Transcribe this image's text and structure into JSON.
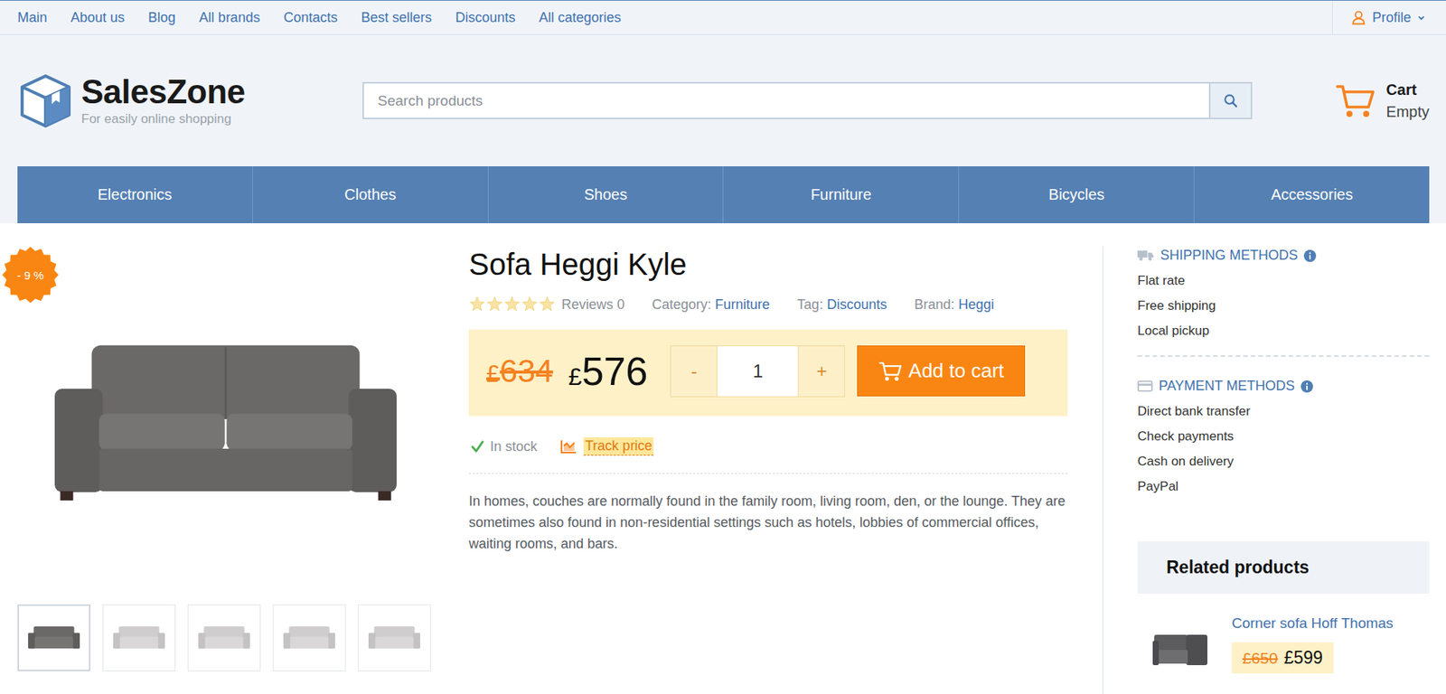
{
  "top_nav": {
    "links": [
      "Main",
      "About us",
      "Blog",
      "All brands",
      "Contacts",
      "Best sellers",
      "Discounts",
      "All categories"
    ],
    "profile": "Profile"
  },
  "logo": {
    "name": "SalesZone",
    "tagline": "For easily online shopping"
  },
  "search": {
    "placeholder": "Search products"
  },
  "cart": {
    "title": "Cart",
    "status": "Empty"
  },
  "categories": [
    "Electronics",
    "Clothes",
    "Shoes",
    "Furniture",
    "Bicycles",
    "Accessories"
  ],
  "product": {
    "badge": "- 9 %",
    "title": "Sofa Heggi Kyle",
    "stars": 0,
    "reviews": "Reviews 0",
    "category_label": "Category:",
    "category": "Furniture",
    "tag_label": "Tag:",
    "tag": "Discounts",
    "brand_label": "Brand:",
    "brand": "Heggi",
    "currency": "£",
    "old_price": "634",
    "price": "576",
    "decrement": "-",
    "quantity": "1",
    "increment": "+",
    "add_to_cart": "Add to cart",
    "stock": "In stock",
    "track_price": {
      "label": "Track price",
      "highlighted": true
    },
    "description": "In homes, couches are normally found in the family room, living room, den, or the lounge. They are sometimes also found in non-residential settings such as hotels, lobbies of commercial offices, waiting rooms, and bars.",
    "thumbnails": [
      {
        "selected": true
      },
      {
        "selected": false
      },
      {
        "selected": false
      },
      {
        "selected": false
      },
      {
        "selected": false
      }
    ]
  },
  "shipping": {
    "title": "SHIPPING METHODS",
    "items": [
      "Flat rate",
      "Free shipping",
      "Local pickup"
    ]
  },
  "payment": {
    "title": "PAYMENT METHODS",
    "items": [
      "Direct bank transfer",
      "Check payments",
      "Cash on delivery",
      "PayPal"
    ]
  },
  "related": {
    "title": "Related products",
    "items": [
      {
        "name": "Corner sofa Hoff Thomas",
        "currency": "£",
        "old_price": "650",
        "price": "599"
      }
    ]
  }
}
